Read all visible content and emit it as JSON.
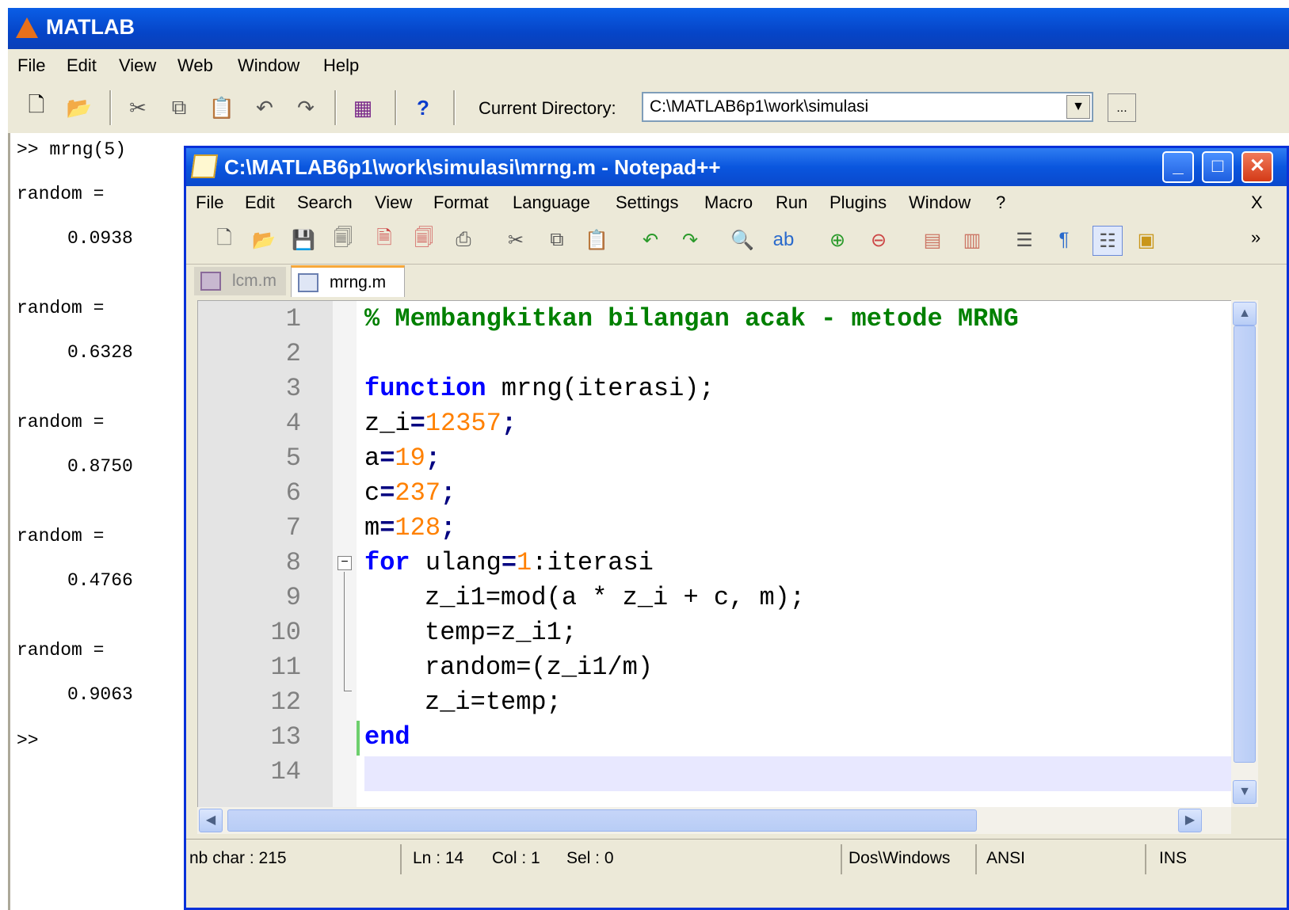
{
  "matlab": {
    "title": "MATLAB",
    "menu": [
      "File",
      "Edit",
      "View",
      "Web",
      "Window",
      "Help"
    ],
    "current_directory_label": "Current Directory:",
    "current_directory_value": "C:\\MATLAB6p1\\work\\simulasi",
    "browse_label": "...",
    "command_window": [
      ">> mrng(5)",
      "random =",
      "0.0938",
      "random =",
      "0.6328",
      "random =",
      "0.8750",
      "random =",
      "0.4766",
      "random =",
      "0.9063",
      ">>"
    ]
  },
  "notepad": {
    "title": "C:\\MATLAB6p1\\work\\simulasi\\mrng.m - Notepad++",
    "menu": [
      "File",
      "Edit",
      "Search",
      "View",
      "Format",
      "Language",
      "Settings",
      "Macro",
      "Run",
      "Plugins",
      "Window",
      "?"
    ],
    "menu_close": "X",
    "toolbar_overflow": "»",
    "tabs": [
      {
        "label": "lcm.m",
        "active": false
      },
      {
        "label": "mrng.m",
        "active": true
      }
    ],
    "line_numbers": [
      "1",
      "2",
      "3",
      "4",
      "5",
      "6",
      "7",
      "8",
      "9",
      "10",
      "11",
      "12",
      "13",
      "14"
    ],
    "code": {
      "l1": "% Membangkitkan bilangan acak - metode MRNG",
      "l3_kw": "function",
      "l3_rest": " mrng(iterasi);",
      "l4_var": "z_i",
      "l4_num": "12357",
      "l5_var": "a",
      "l5_num": "19",
      "l6_var": "c",
      "l6_num": "237",
      "l7_var": "m",
      "l7_num": "128",
      "l8_kw": "for",
      "l8_var": " ulang",
      "l8_num": "1",
      "l8_rest": ":iterasi",
      "l9": "z_i1=mod(a * z_i + c, m);",
      "l10": "temp=z_i1;",
      "l11": "random=(z_i1/m)",
      "l12": "z_i=temp;",
      "l13_kw": "end"
    },
    "status": {
      "nb_char": "nb char : 215",
      "ln": "Ln : 14",
      "col": "Col : 1",
      "sel": "Sel : 0",
      "eol": "Dos\\Windows",
      "encoding": "ANSI",
      "mode": "INS"
    }
  }
}
